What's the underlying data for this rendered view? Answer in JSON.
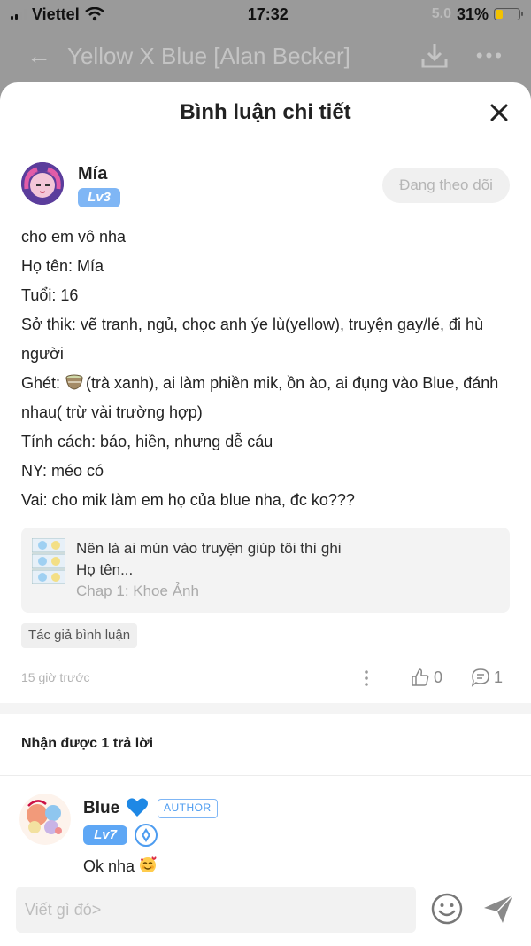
{
  "status_bar": {
    "carrier": "Viettel",
    "time": "17:32",
    "ghost_text": "5.0",
    "battery": "31%",
    "battery_level": 0.31
  },
  "background_header": {
    "title": "Yellow X Blue [Alan Becker]"
  },
  "sheet": {
    "title": "Bình luận chi tiết"
  },
  "comment": {
    "author": "Mía",
    "level": "Lv3",
    "follow_label": "Đang theo dõi",
    "lines": [
      "cho em vô nha",
      "Họ tên: Mía",
      "Tuổi: 16",
      "Sở thik: vẽ tranh, ngủ, chọc anh ýe lù(yellow), truyện gay/lé, đi hù người",
      "(trà xanh), ai làm phiền mik, ồn ào, ai đụng vào Blue, đánh nhau( trừ vài trường hợp)",
      "Tính cách: báo, hiền, nhưng dễ cáu",
      "NY: méo có",
      "Vai: cho mik làm em họ của blue nha, đc ko???"
    ],
    "ghet_prefix": "Ghét: ",
    "quote": {
      "line1": "Nên là ai mún vào truyện giúp tôi thì ghi",
      "line2": "Họ tên...",
      "chapter": "Chap 1: Khoe Ảnh"
    },
    "tag": "Tác giả bình luận",
    "time": "15 giờ trước",
    "likes": "0",
    "replies": "1"
  },
  "replies_section": {
    "header": "Nhận được 1 trả lời",
    "items": [
      {
        "author": "Blue",
        "author_tag": "AUTHOR",
        "level": "Lv7",
        "text": "Ok nha"
      }
    ]
  },
  "input": {
    "placeholder": "Viết gì đó>"
  },
  "colors": {
    "level_badge": "#7fb6f5",
    "accent_blue": "#4d9cf0",
    "heart": "#1e88e5"
  }
}
